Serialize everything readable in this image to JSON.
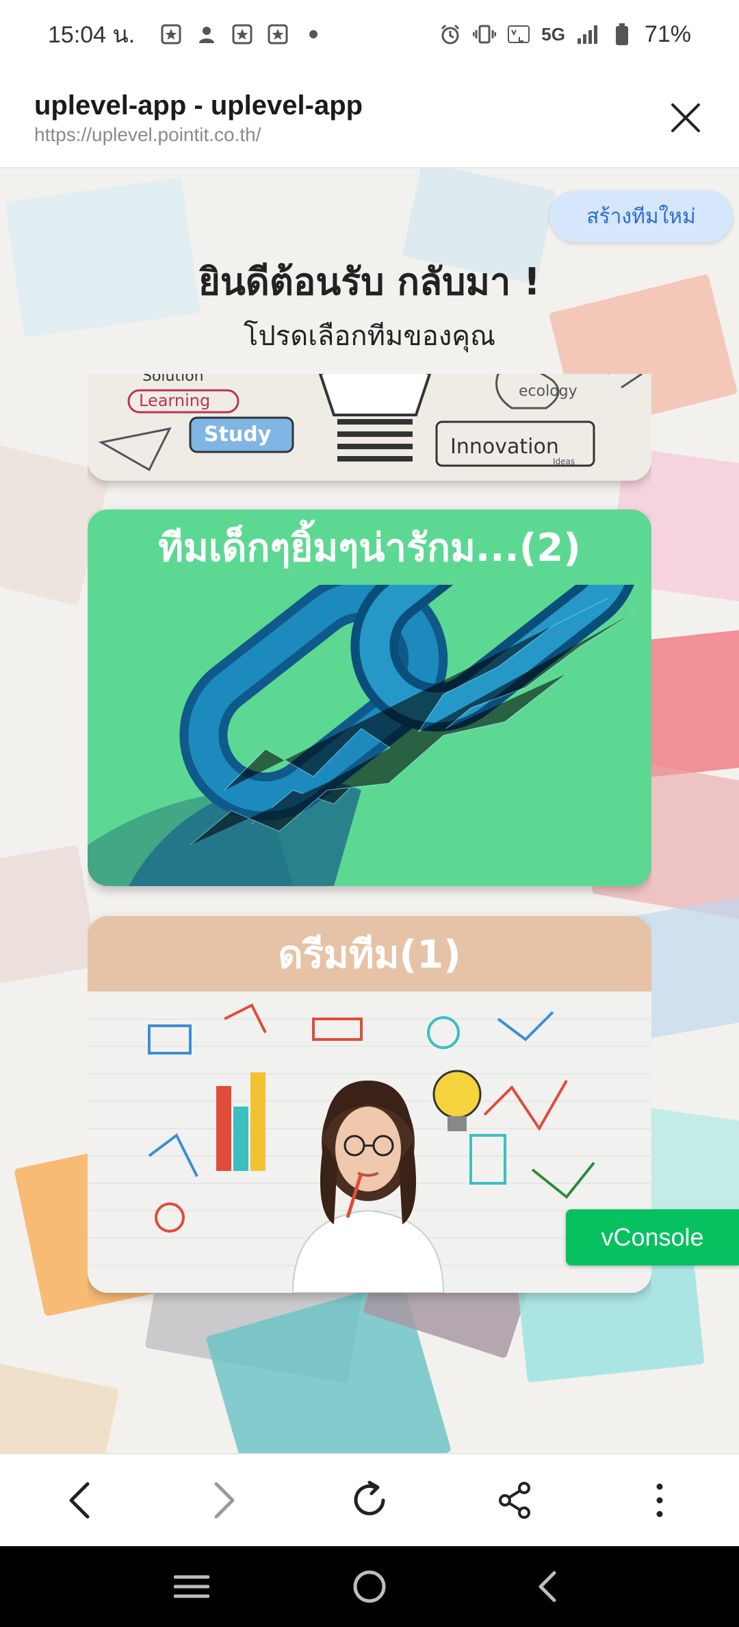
{
  "status_bar": {
    "time": "15:04 น.",
    "network_label": "5G",
    "battery": "71%"
  },
  "browser": {
    "title": "uplevel-app - uplevel-app",
    "url": "https://uplevel.pointit.co.th/"
  },
  "page": {
    "create_team_label": "สร้างทีมใหม่",
    "welcome": "ยินดีต้อนรับ กลับมา !",
    "subtitle": "โปรดเลือกทีมของคุณ",
    "partial_card_words": [
      "Solution",
      "Learning",
      "Study",
      "ecology",
      "Innovation",
      "Ideas"
    ],
    "teams": [
      {
        "name": "ทีมเด็กๆยิ้มๆน่ารักม...(2)",
        "header_color": "#5cd893"
      },
      {
        "name": "ดรีมทีม(1)",
        "header_color": "#e6c2a6"
      }
    ],
    "vconsole_label": "vConsole"
  },
  "colors": {
    "accent_blue": "#2a6fc9",
    "vconsole_green": "#07c160"
  }
}
